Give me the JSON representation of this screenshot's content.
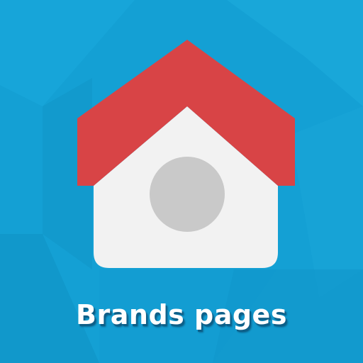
{
  "caption": {
    "text": "Brands pages"
  },
  "colors": {
    "background": "#14a0d4",
    "roof": "#d84446",
    "house_body": "#f2f2f2",
    "window": "#c9c9c9",
    "caption_text": "#ffffff"
  },
  "icons": {
    "main": "house-icon"
  }
}
